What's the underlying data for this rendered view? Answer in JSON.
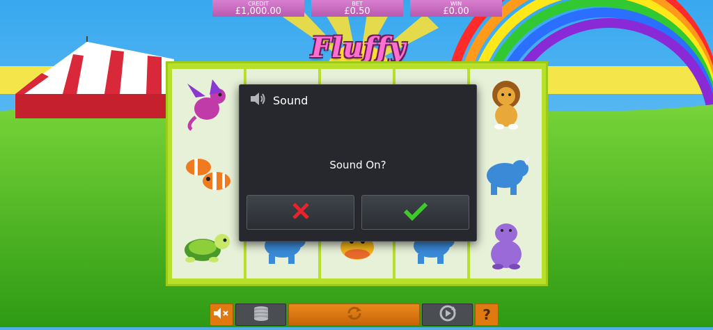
{
  "header": {
    "credit_label": "CREDIT",
    "credit_value": "£1,000.00",
    "bet_label": "BET",
    "bet_value": "£0.50",
    "win_label": "WIN",
    "win_value": "£0.00"
  },
  "game": {
    "title": "Fluffy Favourites"
  },
  "reels": [
    [
      "dragon-icon",
      "clownfish-icon",
      "turtle-icon"
    ],
    [
      "",
      "",
      "rhino-icon"
    ],
    [
      "",
      "",
      "duck-icon"
    ],
    [
      "",
      "",
      "rhino-icon"
    ],
    [
      "lion-icon",
      "rhino-icon",
      "hippo-icon"
    ]
  ],
  "dialog": {
    "title": "Sound",
    "message": "Sound On?",
    "cancel_icon": "x-icon",
    "confirm_icon": "checkmark-icon"
  },
  "controls": [
    "mute-icon",
    "coins-icon",
    "spin-icon",
    "autoplay-icon",
    "help-icon"
  ],
  "colors": {
    "accent": "#ff6fd0",
    "reel_frame": "#b8e02a",
    "button_orange": "#e07a10",
    "cancel": "#e8232a",
    "confirm": "#3fc92a"
  }
}
